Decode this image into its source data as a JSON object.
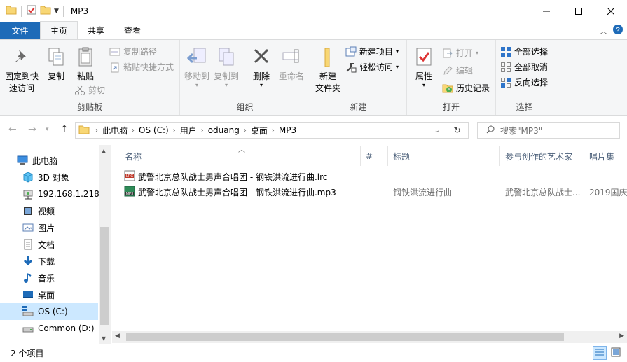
{
  "window": {
    "title": "MP3"
  },
  "tabs": {
    "file": "文件",
    "home": "主页",
    "share": "共享",
    "view": "查看"
  },
  "ribbon": {
    "clipboard": {
      "label": "剪贴板",
      "pin": "固定到快速访问",
      "pin_line1": "固定到快",
      "pin_line2": "速访问",
      "copy": "复制",
      "paste": "粘贴",
      "copy_path": "复制路径",
      "paste_shortcut": "粘贴快捷方式",
      "cut": "剪切"
    },
    "organize": {
      "label": "组织",
      "move_to": "移动到",
      "copy_to": "复制到",
      "delete": "删除",
      "rename": "重命名"
    },
    "new": {
      "label": "新建",
      "new_folder_line1": "新建",
      "new_folder_line2": "文件夹",
      "new_item": "新建项目",
      "easy_access": "轻松访问"
    },
    "open": {
      "label": "打开",
      "properties": "属性",
      "open": "打开",
      "edit": "编辑",
      "history": "历史记录"
    },
    "select": {
      "label": "选择",
      "select_all": "全部选择",
      "select_none": "全部取消",
      "invert": "反向选择"
    }
  },
  "address": {
    "crumbs": [
      "此电脑",
      "OS (C:)",
      "用户",
      "oduang",
      "桌面",
      "MP3"
    ],
    "search_placeholder": "搜索\"MP3\""
  },
  "nav": {
    "items": [
      {
        "label": "此电脑",
        "icon": "computer-icon"
      },
      {
        "label": "3D 对象",
        "icon": "cube-icon"
      },
      {
        "label": "192.168.1.218",
        "icon": "network-drive-icon"
      },
      {
        "label": "视频",
        "icon": "video-icon"
      },
      {
        "label": "图片",
        "icon": "picture-icon"
      },
      {
        "label": "文档",
        "icon": "document-icon"
      },
      {
        "label": "下载",
        "icon": "download-icon"
      },
      {
        "label": "音乐",
        "icon": "music-icon"
      },
      {
        "label": "桌面",
        "icon": "desktop-icon"
      },
      {
        "label": "OS (C:)",
        "icon": "os-drive-icon"
      },
      {
        "label": "Common (D:)",
        "icon": "drive-icon"
      }
    ]
  },
  "columns": {
    "name": "名称",
    "number": "#",
    "title": "标题",
    "artist": "参与创作的艺术家",
    "album": "唱片集"
  },
  "files": [
    {
      "name": "武警北京总队战士男声合唱团 - 钢铁洪流进行曲.lrc",
      "title": "",
      "artist": "",
      "album": "",
      "icon": "lrc-file-icon"
    },
    {
      "name": "武警北京总队战士男声合唱团 - 钢铁洪流进行曲.mp3",
      "title": "钢铁洪流进行曲",
      "artist": "武警北京总队战士...",
      "album": "2019国庆",
      "icon": "mp3-file-icon"
    }
  ],
  "status": {
    "count": "2 个项目"
  },
  "colors": {
    "accent": "#1e6bb8",
    "selection": "#cce8ff"
  }
}
